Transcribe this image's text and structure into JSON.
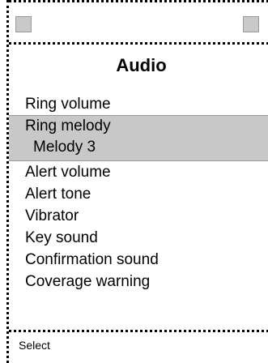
{
  "screen": {
    "title": "Audio"
  },
  "menu": {
    "items": [
      {
        "label": "Ring volume"
      },
      {
        "label": "Ring melody",
        "value": "Melody 3"
      },
      {
        "label": "Alert volume"
      },
      {
        "label": "Alert tone"
      },
      {
        "label": "Vibrator"
      },
      {
        "label": "Key sound"
      },
      {
        "label": "Confirmation sound"
      },
      {
        "label": "Coverage warning"
      }
    ],
    "selected_index": 1
  },
  "softkeys": {
    "left": "Select"
  },
  "colors": {
    "highlight": "#c8c8c8",
    "icon_placeholder": "#c9c9c9"
  },
  "icons": {
    "status_left": "status-placeholder-icon",
    "status_right": "status-placeholder-icon"
  }
}
